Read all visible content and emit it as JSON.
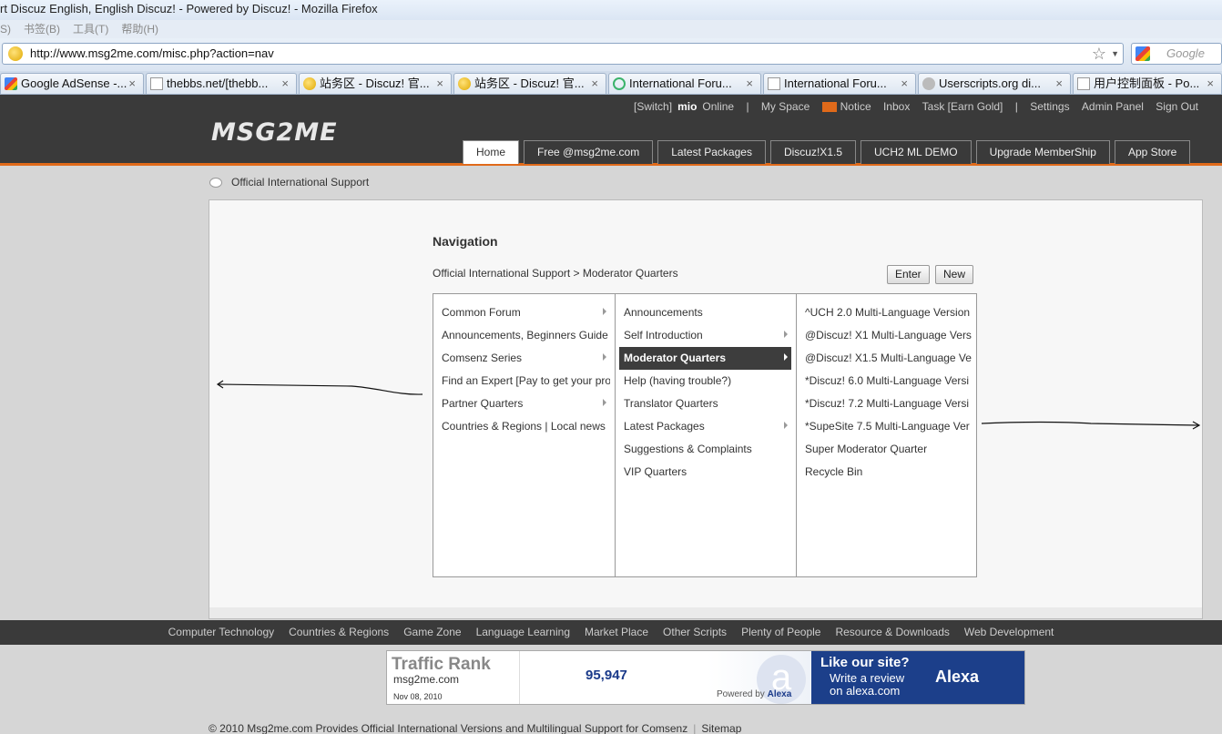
{
  "browser": {
    "title": "rt Discuz English, English Discuz! - Powered by Discuz! - Mozilla Firefox",
    "menu": [
      "S)",
      "书签(B)",
      "工具(T)",
      "帮助(H)"
    ],
    "url": "http://www.msg2me.com/misc.php?action=nav",
    "search_placeholder": "Google",
    "tabs": [
      {
        "label": "Google AdSense -...",
        "icon": "google-icon"
      },
      {
        "label": "thebbs.net/[thebb...",
        "icon": "page-icon"
      },
      {
        "label": "站务区 - Discuz! 官...",
        "icon": "discuz-icon"
      },
      {
        "label": "站务区 - Discuz! 官...",
        "icon": "discuz-icon"
      },
      {
        "label": "International Foru...",
        "icon": "globe-icon"
      },
      {
        "label": "International Foru...",
        "icon": "page-icon"
      },
      {
        "label": "Userscripts.org di...",
        "icon": "userscripts-icon"
      },
      {
        "label": "用户控制面板 - Po...",
        "icon": "page-icon"
      }
    ]
  },
  "site": {
    "logo": "MSG2ME",
    "toplinks": {
      "switch": "[Switch]",
      "user": "mio",
      "status": "Online",
      "sep1": "|",
      "myspace": "My Space",
      "notice": "Notice",
      "inbox": "Inbox",
      "task": "Task [Earn Gold]",
      "sep2": "|",
      "settings": "Settings",
      "admin": "Admin Panel",
      "signout": "Sign Out"
    },
    "nav": [
      "Home",
      "Free @msg2me.com",
      "Latest Packages",
      "Discuz!X1.5",
      "UCH2 ML DEMO",
      "Upgrade MemberShip",
      "App Store"
    ],
    "breadcrumb": "Official International Support"
  },
  "navigation": {
    "title": "Navigation",
    "path": "Official International Support > Moderator Quarters",
    "enter": "Enter",
    "new": "New",
    "col1": [
      {
        "label": "Common Forum",
        "arrow": true
      },
      {
        "label": "Announcements, Beginners Guide",
        "arrow": false
      },
      {
        "label": "Comsenz Series",
        "arrow": true
      },
      {
        "label": "Find an Expert [Pay to get your pro",
        "arrow": false
      },
      {
        "label": "Partner Quarters",
        "arrow": true
      },
      {
        "label": "Countries & Regions | Local news",
        "arrow": false
      }
    ],
    "col2": [
      {
        "label": "Announcements",
        "arrow": false
      },
      {
        "label": "Self Introduction",
        "arrow": true
      },
      {
        "label": "Moderator Quarters",
        "arrow": true,
        "selected": true
      },
      {
        "label": "Help (having trouble?)",
        "arrow": false
      },
      {
        "label": "Translator Quarters",
        "arrow": false
      },
      {
        "label": "Latest Packages",
        "arrow": true
      },
      {
        "label": "Suggestions & Complaints",
        "arrow": false
      },
      {
        "label": "VIP Quarters",
        "arrow": false
      }
    ],
    "col3": [
      {
        "label": "^UCH 2.0 Multi-Language Version"
      },
      {
        "label": "@Discuz! X1 Multi-Language Vers"
      },
      {
        "label": "@Discuz! X1.5 Multi-Language Ve"
      },
      {
        "label": "*Discuz! 6.0 Multi-Language Versi"
      },
      {
        "label": "*Discuz! 7.2 Multi-Language Versi"
      },
      {
        "label": "*SupeSite 7.5 Multi-Language Ver"
      },
      {
        "label": "Super Moderator Quarter"
      },
      {
        "label": "Recycle Bin"
      }
    ]
  },
  "footer": {
    "links": [
      "Computer Technology",
      "Countries & Regions",
      "Game Zone",
      "Language Learning",
      "Market Place",
      "Other Scripts",
      "Plenty of People",
      "Resource & Downloads",
      "Web Development"
    ],
    "alexa": {
      "title": "Traffic Rank",
      "domain": "msg2me.com",
      "date": "Nov 08, 2010",
      "rank": "95,947",
      "powered": "Powered by",
      "powered_brand": "Alexa",
      "like": "Like our site?",
      "review1": "Write a review",
      "review2": "on alexa.com",
      "brand": "Alexa"
    },
    "copyright": "© 2010 Msg2me.com Provides Official International Versions and Multilingual Support for Comsenz",
    "sitemap": "Sitemap",
    "sep": "|"
  }
}
